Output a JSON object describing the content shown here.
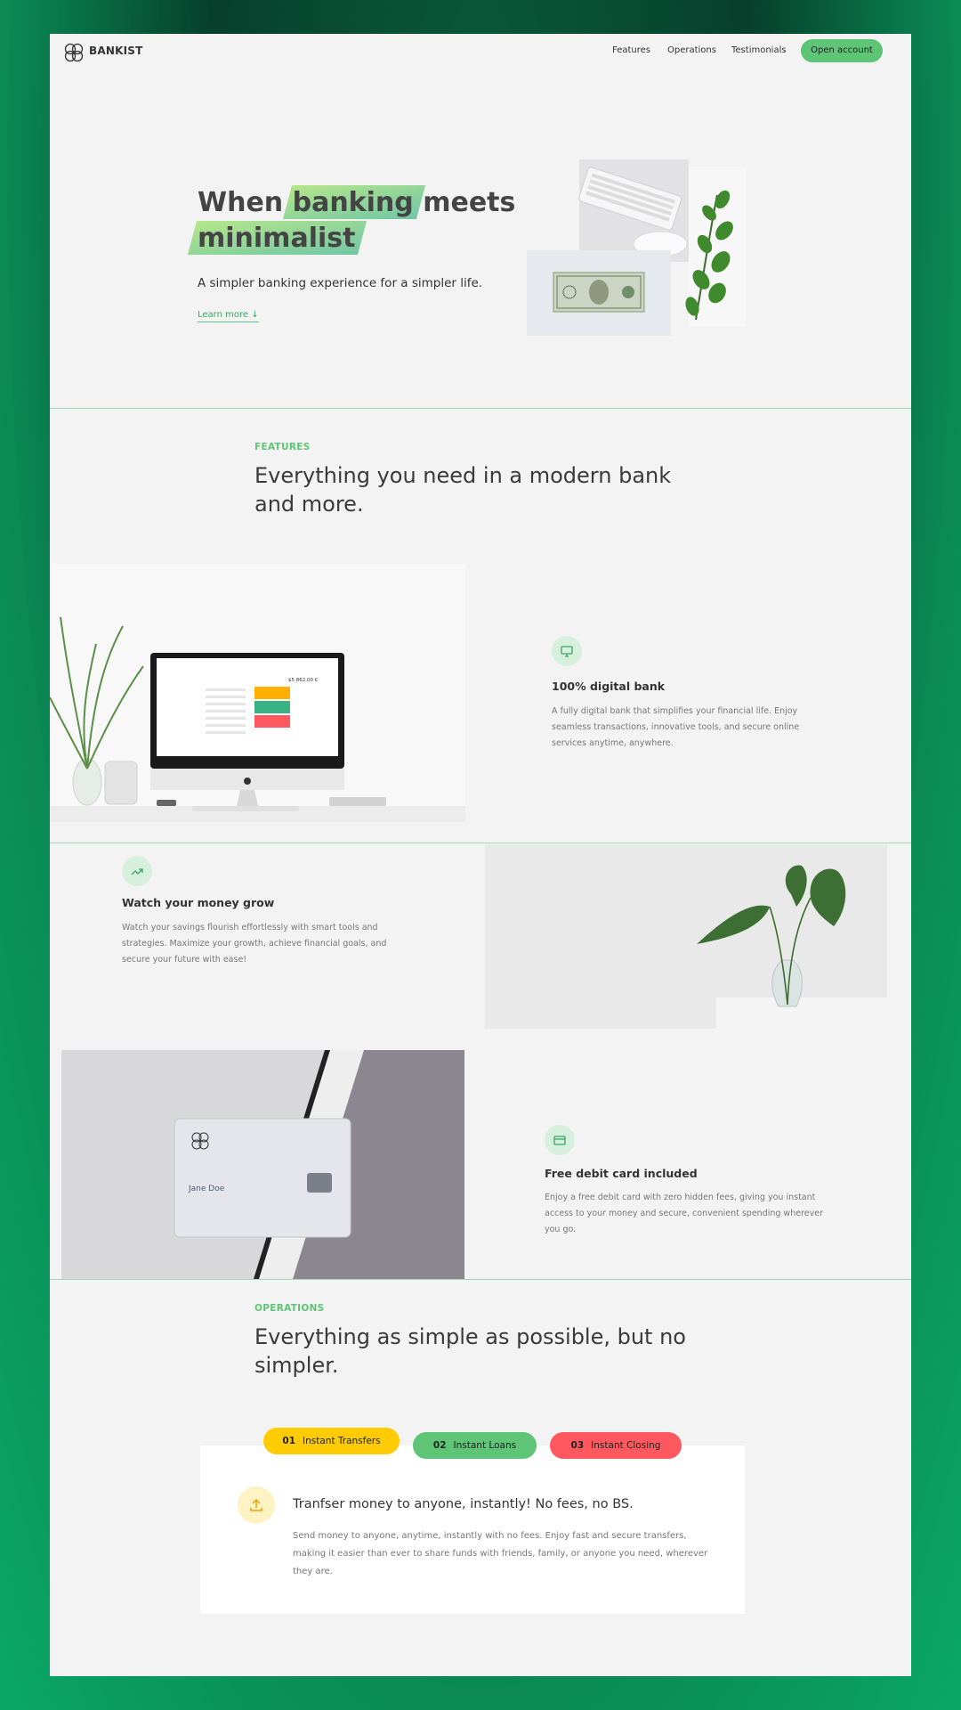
{
  "nav": {
    "brand": "BANKIST",
    "links": [
      "Features",
      "Operations",
      "Testimonials"
    ],
    "cta": "Open account"
  },
  "hero": {
    "title_1": "When",
    "title_highlight_1": "banking",
    "title_2": "meets",
    "title_highlight_2": "minimalist",
    "subtitle": "A simpler banking experience for a simpler life.",
    "learn_more": "Learn more ↓"
  },
  "features": {
    "label": "FEATURES",
    "title": "Everything you need in a modern bank and more.",
    "items": [
      {
        "title": "100% digital bank",
        "text": "A fully digital bank that simplifies your financial life. Enjoy seamless transactions, innovative tools, and secure online services anytime, anywhere.",
        "icon": "monitor-icon"
      },
      {
        "title": "Watch your money grow",
        "text": "Watch your savings flourish effortlessly with smart tools and strategies. Maximize your growth, achieve financial goals, and secure your future with ease!",
        "icon": "trending-up-icon"
      },
      {
        "title": "Free debit card included",
        "text": "Enjoy a free debit card with zero hidden fees, giving you instant access to your money and secure, convenient spending wherever you go.",
        "icon": "credit-card-icon"
      }
    ],
    "monitor_balance": "$5 862,00 €",
    "card_name": "Jane Doe"
  },
  "operations": {
    "label": "OPERATIONS",
    "title": "Everything as simple as possible, but no simpler.",
    "tabs": [
      {
        "num": "01",
        "label": "Instant Transfers",
        "color": "#ffcb03"
      },
      {
        "num": "02",
        "label": "Instant Loans",
        "color": "#5ec576"
      },
      {
        "num": "03",
        "label": "Instant Closing",
        "color": "#ff585f"
      }
    ],
    "content_title": "Tranfser money to anyone, instantly! No fees, no BS.",
    "content_text": "Send money to anyone, anytime, instantly with no fees. Enjoy fast and secure transfers, making it easier than ever to share funds with friends, family, or anyone you need, wherever they are."
  },
  "colors": {
    "accent": "#5ec576",
    "yellow": "#ffcb03",
    "red": "#ff585f"
  }
}
